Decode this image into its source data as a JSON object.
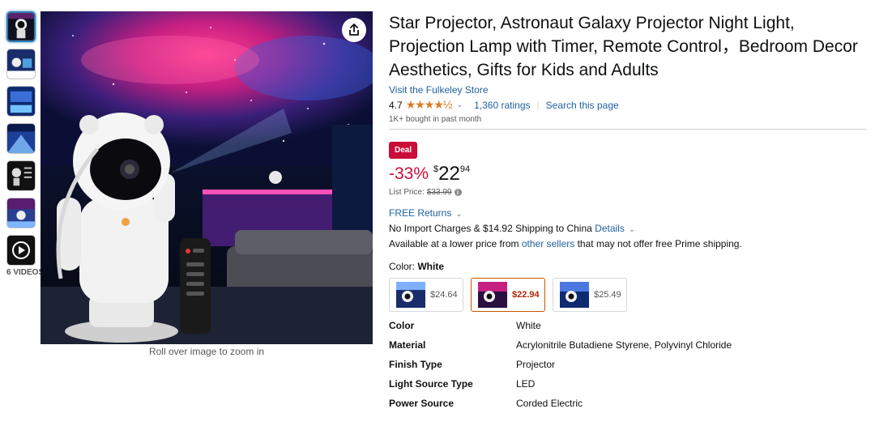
{
  "gallery": {
    "video_label": "6 VIDEOS",
    "zoom_hint": "Roll over image to zoom in"
  },
  "product": {
    "title": "Star Projector, Astronaut Galaxy Projector Night Light, Projection Lamp with Timer, Remote Control，Bedroom Decor Aesthetics, Gifts for Kids and Adults",
    "store_link": "Visit the Fulkeley Store",
    "rating": "4.7",
    "stars": "★★★★½",
    "ratings_count": "1,360 ratings",
    "search_page": "Search this page",
    "bought": "1K+ bought in past month"
  },
  "pricing": {
    "deal_badge": "Deal",
    "discount": "-33%",
    "currency": "$",
    "whole": "22",
    "fraction": "94",
    "list_price_label": "List Price:",
    "list_price": "$33.99",
    "free_returns": "FREE Returns",
    "shipping": "No Import Charges & $14.92 Shipping to China",
    "details_link": "Details",
    "available_prefix": "Available at a lower price from",
    "other_sellers": "other sellers",
    "available_suffix": "that may not offer free Prime shipping."
  },
  "variant": {
    "label": "Color:",
    "selected": "White",
    "options": [
      {
        "price": "$24.64"
      },
      {
        "price": "$22.94"
      },
      {
        "price": "$25.49"
      }
    ]
  },
  "specs": [
    {
      "key": "Color",
      "value": "White"
    },
    {
      "key": "Material",
      "value": "Acrylonitrile Butadiene Styrene, Polyvinyl Chloride"
    },
    {
      "key": "Finish Type",
      "value": "Projector"
    },
    {
      "key": "Light Source Type",
      "value": "LED"
    },
    {
      "key": "Power Source",
      "value": "Corded Electric"
    }
  ],
  "colors": {
    "deal_red": "#cc0c39",
    "link_blue": "#2162a1",
    "star_orange": "#de7921",
    "selected_border": "#c45500"
  },
  "icons": [
    "share-icon",
    "play-icon",
    "info-icon",
    "chevron-down-icon",
    "star-icon"
  ]
}
